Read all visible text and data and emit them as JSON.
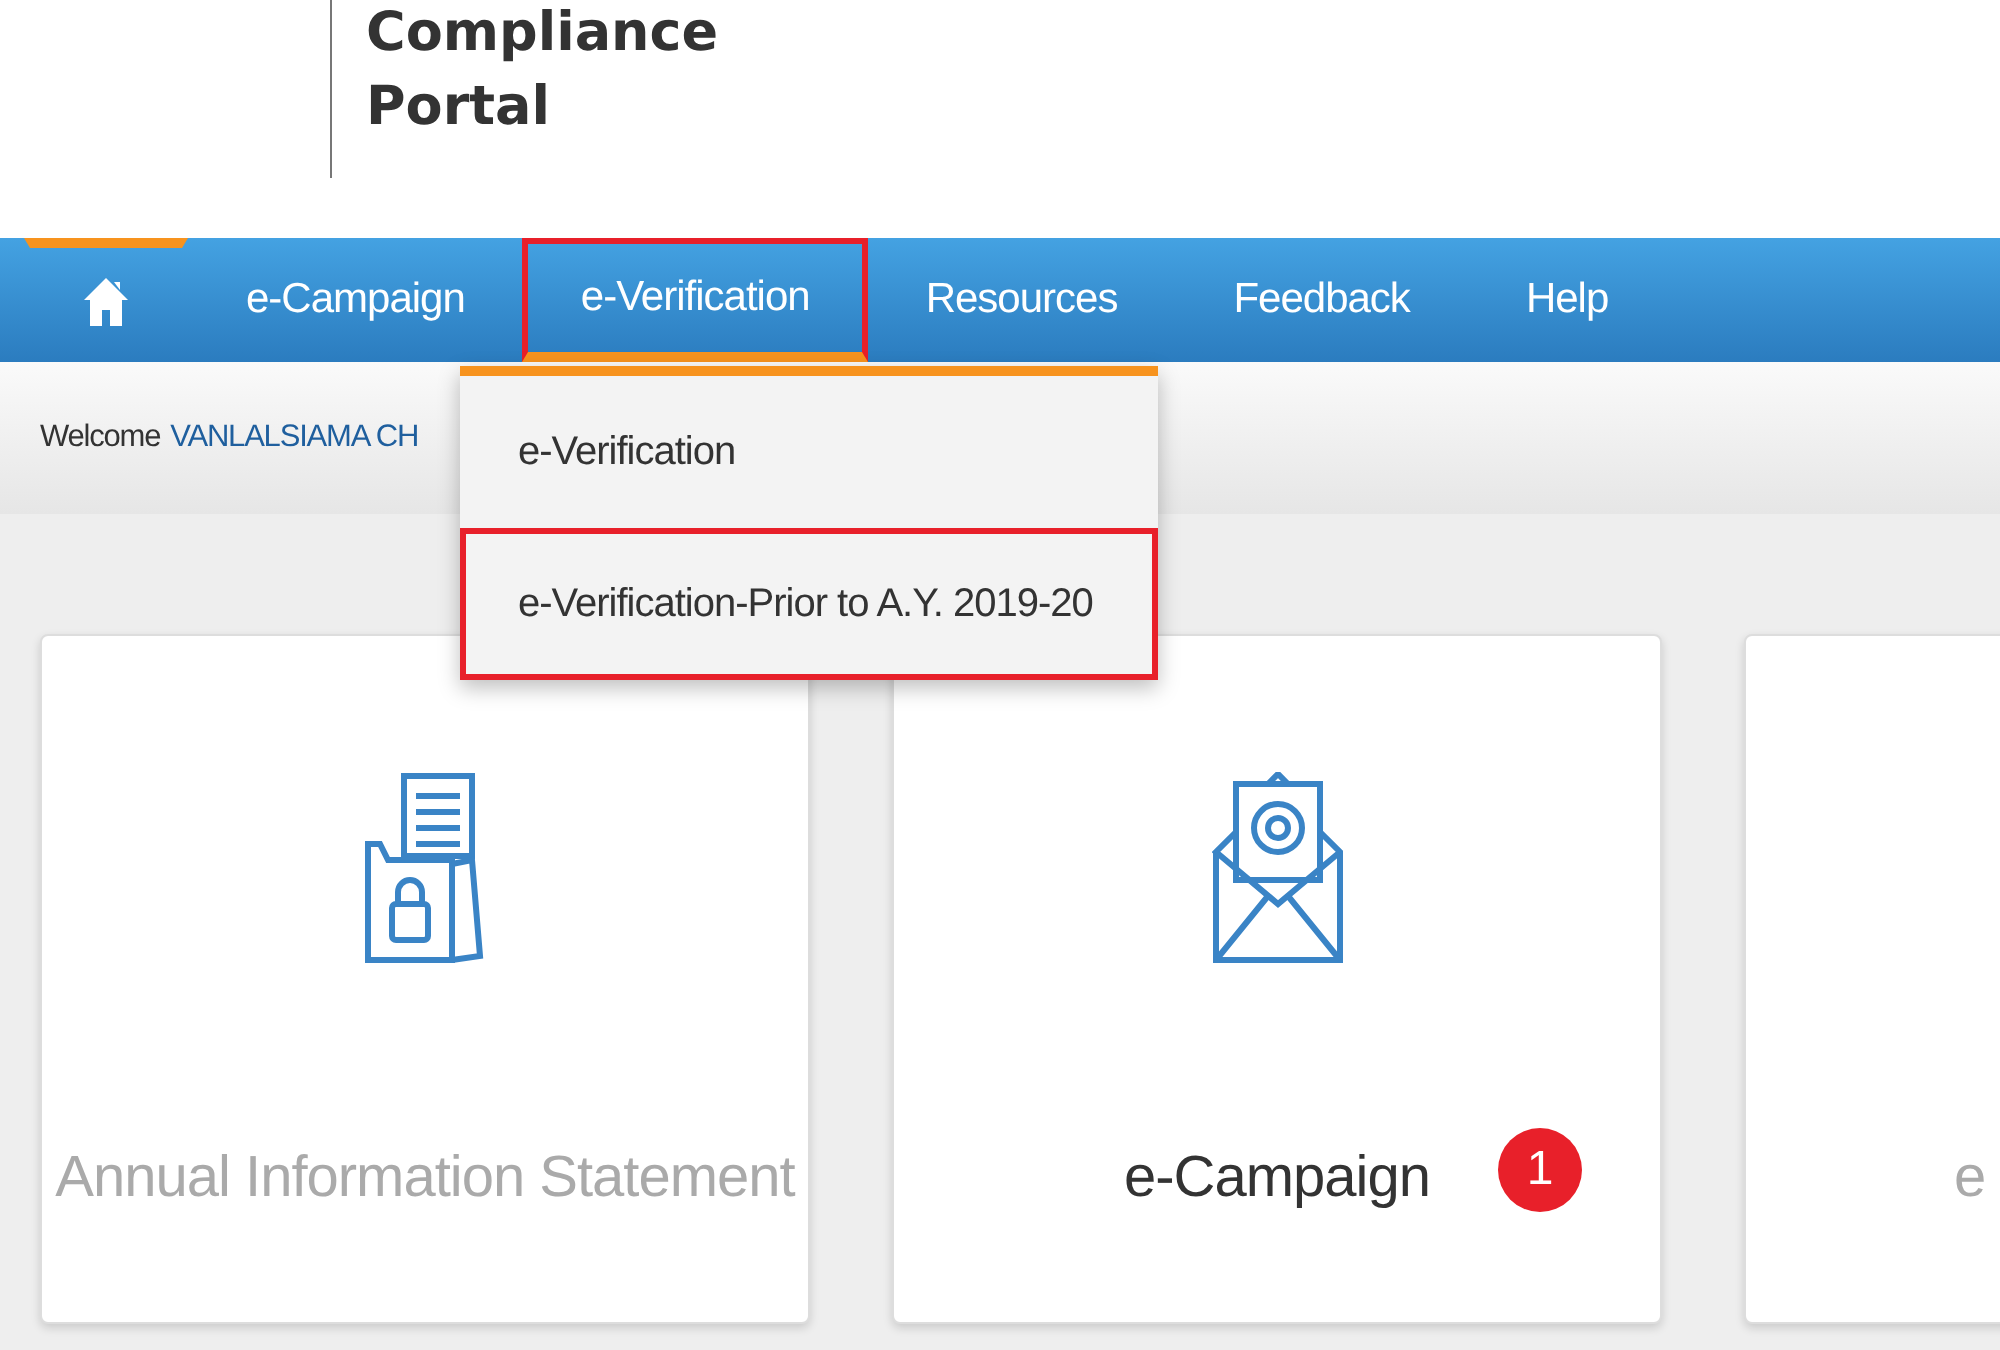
{
  "header": {
    "title_lines": [
      "Compliance",
      "Portal"
    ]
  },
  "nav": [
    {
      "kind": "home",
      "active": true,
      "highlighted": false
    },
    {
      "kind": "link",
      "label": "e-Campaign",
      "active": false,
      "highlighted": false
    },
    {
      "kind": "link",
      "label": "e-Verification",
      "active": false,
      "highlighted": true,
      "expanded": true
    },
    {
      "kind": "link",
      "label": "Resources",
      "active": false,
      "highlighted": false
    },
    {
      "kind": "link",
      "label": "Feedback",
      "active": false,
      "highlighted": false
    },
    {
      "kind": "link",
      "label": "Help",
      "active": false,
      "highlighted": false
    }
  ],
  "dropdown": [
    {
      "label": "e-Verification",
      "highlighted": false
    },
    {
      "label": "e-Verification-Prior to A.Y. 2019-20",
      "highlighted": true
    }
  ],
  "welcome": {
    "prefix": "Welcome",
    "name": "VANLALSIAMA CH"
  },
  "cards": [
    {
      "title": "Annual Information Statement",
      "disabled": true
    },
    {
      "title": "e-Campaign",
      "disabled": false,
      "badge": "1"
    },
    {
      "title": "e",
      "disabled": true
    }
  ]
}
